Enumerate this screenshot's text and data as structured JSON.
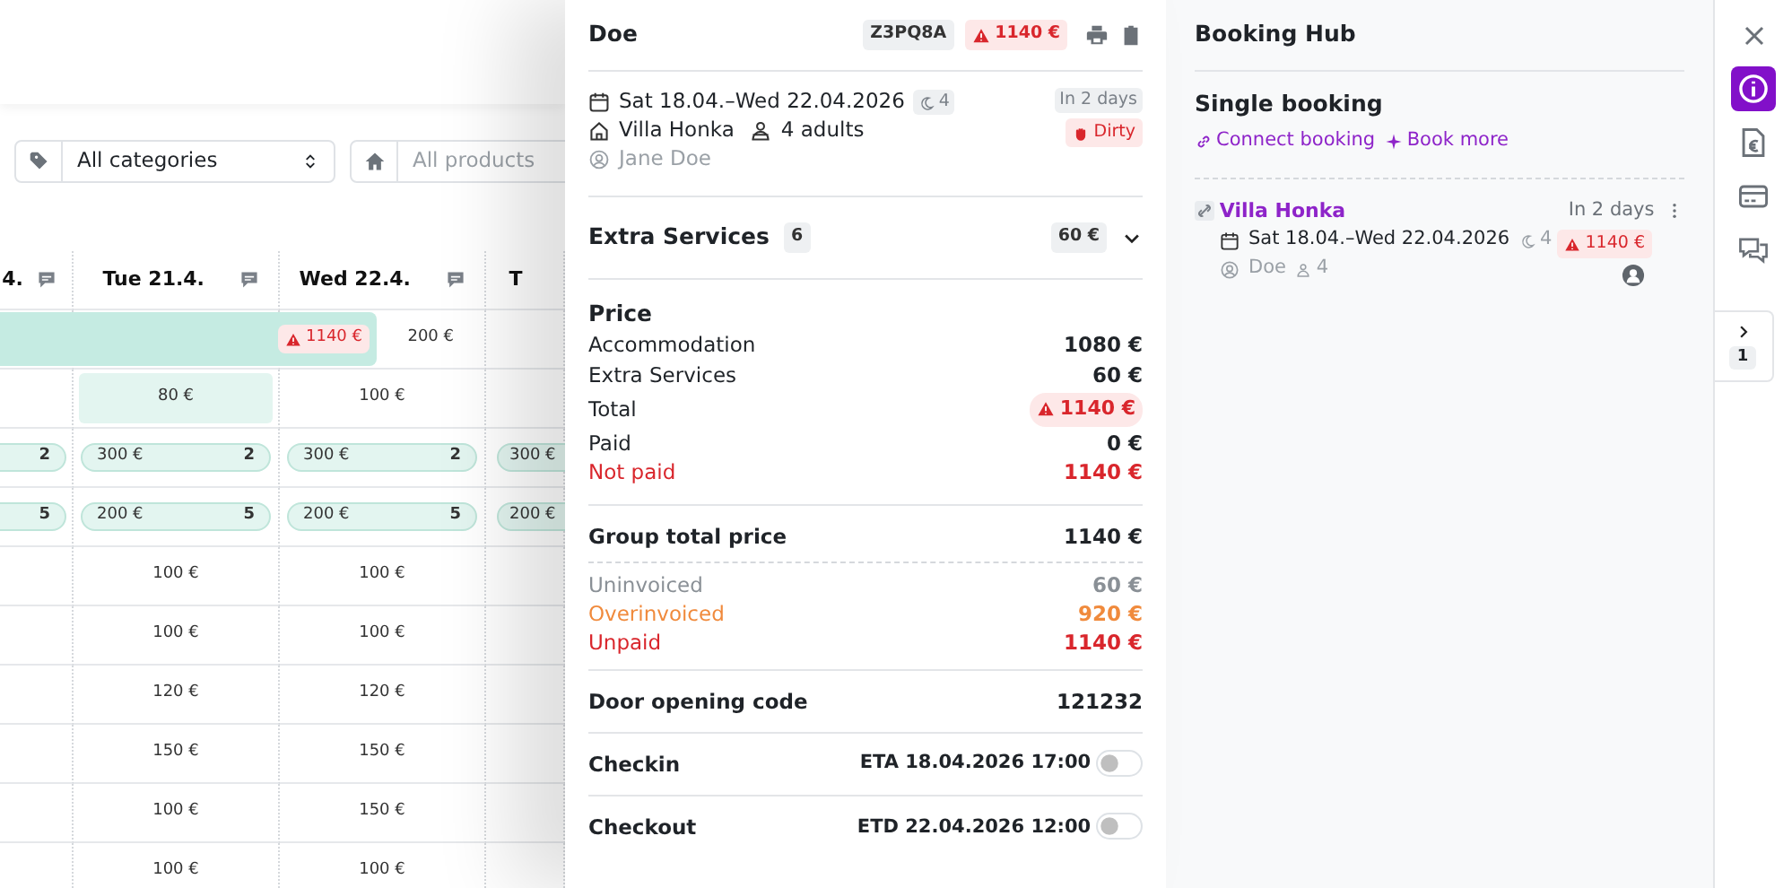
{
  "calendar": {
    "filters": [
      {
        "kind": "select",
        "value": "All categories"
      },
      {
        "kind": "input",
        "placeholder": "All products"
      }
    ],
    "columns": [
      {
        "label": "4.",
        "note": true
      },
      {
        "label": "Tue 21.4.",
        "note": true
      },
      {
        "label": "Wed 22.4.",
        "note": true
      },
      {
        "label": "T",
        "note": false
      }
    ],
    "booking_bar": {
      "amount": "1140 €",
      "next": "200 €"
    },
    "rows": [
      {
        "cells": [
          {
            "kind": "empty"
          },
          {
            "kind": "tinted",
            "text": "80 €"
          },
          {
            "kind": "text",
            "text": "100 €"
          },
          {
            "kind": "empty"
          }
        ]
      },
      {
        "cells": [
          {
            "kind": "pill",
            "count": "2"
          },
          {
            "kind": "pill",
            "text": "300 €",
            "count": "2"
          },
          {
            "kind": "pill",
            "text": "300 €",
            "count": "2"
          },
          {
            "kind": "pill",
            "text": "300 €"
          }
        ]
      },
      {
        "cells": [
          {
            "kind": "pill",
            "count": "5"
          },
          {
            "kind": "pill",
            "text": "200 €",
            "count": "5"
          },
          {
            "kind": "pill",
            "text": "200 €",
            "count": "5"
          },
          {
            "kind": "pill",
            "text": "200 €"
          }
        ]
      },
      {
        "cells": [
          {
            "kind": "empty"
          },
          {
            "kind": "text",
            "text": "100 €"
          },
          {
            "kind": "text",
            "text": "100 €"
          },
          {
            "kind": "empty"
          }
        ]
      },
      {
        "cells": [
          {
            "kind": "empty"
          },
          {
            "kind": "text",
            "text": "100 €"
          },
          {
            "kind": "text",
            "text": "100 €"
          },
          {
            "kind": "empty"
          }
        ]
      },
      {
        "cells": [
          {
            "kind": "empty"
          },
          {
            "kind": "text",
            "text": "120 €"
          },
          {
            "kind": "text",
            "text": "120 €"
          },
          {
            "kind": "empty"
          }
        ]
      },
      {
        "cells": [
          {
            "kind": "empty"
          },
          {
            "kind": "text",
            "text": "150 €"
          },
          {
            "kind": "text",
            "text": "150 €"
          },
          {
            "kind": "empty"
          }
        ]
      },
      {
        "cells": [
          {
            "kind": "empty"
          },
          {
            "kind": "text",
            "text": "100 €"
          },
          {
            "kind": "text",
            "text": "150 €"
          },
          {
            "kind": "empty"
          }
        ]
      },
      {
        "cells": [
          {
            "kind": "empty"
          },
          {
            "kind": "text",
            "text": "100 €"
          },
          {
            "kind": "text",
            "text": "100 €"
          },
          {
            "kind": "empty"
          }
        ]
      }
    ]
  },
  "booking": {
    "guest": "Doe",
    "code": "Z3PQ8A",
    "alert": "1140 €",
    "dates": "Sat 18.04.–Wed 22.04.2026",
    "nights": "4",
    "when": "In 2 days",
    "property": "Villa Honka",
    "occupancy": "4 adults",
    "housekeeping": "Dirty",
    "contact": "Jane Doe",
    "extras": {
      "label": "Extra Services",
      "count": "6",
      "amount": "60 €",
      "expanded": false
    },
    "price": {
      "title": "Price",
      "rows": [
        {
          "label": "Accommodation",
          "value": "1080 €",
          "color": "#1f2328",
          "alert": false
        },
        {
          "label": "Extra Services",
          "value": "60 €",
          "color": "#1f2328",
          "alert": false
        },
        {
          "label": "Total",
          "value": "1140 €",
          "color": "#1f2328",
          "alert": true
        },
        {
          "label": "Paid",
          "value": "0 €",
          "color": "#1f2328",
          "alert": false
        },
        {
          "label": "Not paid",
          "value": "1140 €",
          "color": "#d9262c",
          "alert": false
        }
      ]
    },
    "group": {
      "label": "Group total price",
      "value": "1140 €",
      "rows": [
        {
          "label": "Uninvoiced",
          "value": "60 €",
          "color": "#8a9096"
        },
        {
          "label": "Overinvoiced",
          "value": "920 €",
          "color": "#f08a3c"
        },
        {
          "label": "Unpaid",
          "value": "1140 €",
          "color": "#d9262c"
        }
      ]
    },
    "door": {
      "label": "Door opening code",
      "value": "121232"
    },
    "checks": [
      {
        "label": "Checkin",
        "time": "ETA 18.04.2026 17:00",
        "on": false
      },
      {
        "label": "Checkout",
        "time": "ETD 22.04.2026 12:00",
        "on": false
      }
    ]
  },
  "hub": {
    "title": "Booking Hub",
    "section": "Single booking",
    "actions": [
      {
        "label": "Connect booking"
      },
      {
        "label": "Book more"
      }
    ],
    "bookings": [
      {
        "name": "Villa Honka",
        "when": "In 2 days",
        "dates": "Sat 18.04.–Wed 22.04.2026",
        "nights": "4",
        "amount": "1140 €",
        "guest": "Doe",
        "guests": "4"
      }
    ]
  },
  "rail": {
    "items": [
      {
        "selected": true
      },
      {
        "selected": false
      },
      {
        "selected": false
      },
      {
        "selected": false
      }
    ],
    "tab_count": "1"
  }
}
